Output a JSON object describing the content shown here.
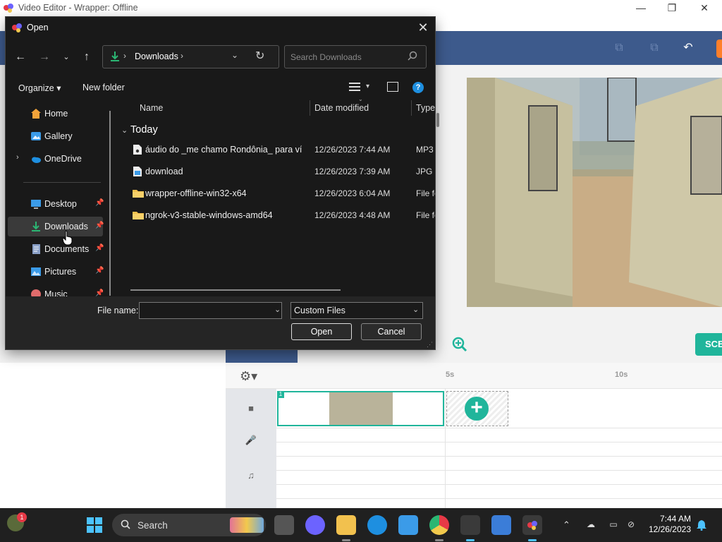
{
  "app": {
    "title": "Video Editor - Wrapper: Offline",
    "timeline_marks": [
      "5s",
      "10s"
    ],
    "clip_number": "1",
    "scene_button": "SCE"
  },
  "dialog": {
    "title": "Open",
    "breadcrumb": "Downloads",
    "search_placeholder": "Search Downloads",
    "commands": {
      "organize": "Organize",
      "new_folder": "New folder",
      "help": "?"
    },
    "nav": [
      {
        "label": "Home",
        "icon": "home-icon",
        "color": "#f2a33a"
      },
      {
        "label": "Gallery",
        "icon": "gallery-icon",
        "color": "#3b9be8"
      },
      {
        "label": "OneDrive",
        "icon": "cloud-icon",
        "color": "#1e8fe0"
      },
      {
        "label": "Desktop",
        "icon": "desktop-icon",
        "color": "#3b9be8"
      },
      {
        "label": "Downloads",
        "icon": "download-icon",
        "color": "#2bb673"
      },
      {
        "label": "Documents",
        "icon": "documents-icon",
        "color": "#8aa0c8"
      },
      {
        "label": "Pictures",
        "icon": "pictures-icon",
        "color": "#3b9be8"
      },
      {
        "label": "Music",
        "icon": "music-icon",
        "color": "#e06b6b"
      }
    ],
    "columns": {
      "name": "Name",
      "date": "Date modified",
      "type": "Type"
    },
    "group": "Today",
    "files": [
      {
        "name": "áudio do _me chamo Rondônia_ para ví...",
        "date": "12/26/2023 7:44 AM",
        "type": "MP3",
        "icon": "audio-file-icon"
      },
      {
        "name": "download",
        "date": "12/26/2023 7:39 AM",
        "type": "JPG F",
        "icon": "image-file-icon"
      },
      {
        "name": "wrapper-offline-win32-x64",
        "date": "12/26/2023 6:04 AM",
        "type": "File fo",
        "icon": "folder-icon"
      },
      {
        "name": "ngrok-v3-stable-windows-amd64",
        "date": "12/26/2023 4:48 AM",
        "type": "File fo",
        "icon": "folder-icon"
      }
    ],
    "file_name_label": "File name:",
    "file_name_value": "",
    "filter": "Custom Files",
    "open_label": "Open",
    "cancel_label": "Cancel"
  },
  "taskbar": {
    "search_label": "Search",
    "widget_badge": "1",
    "time": "7:44 AM",
    "date": "12/26/2023"
  },
  "colors": {
    "accent": "#20b59b",
    "toolbar": "#3d5a8c",
    "dialog_bg": "#191919",
    "taskbar": "#202020"
  }
}
